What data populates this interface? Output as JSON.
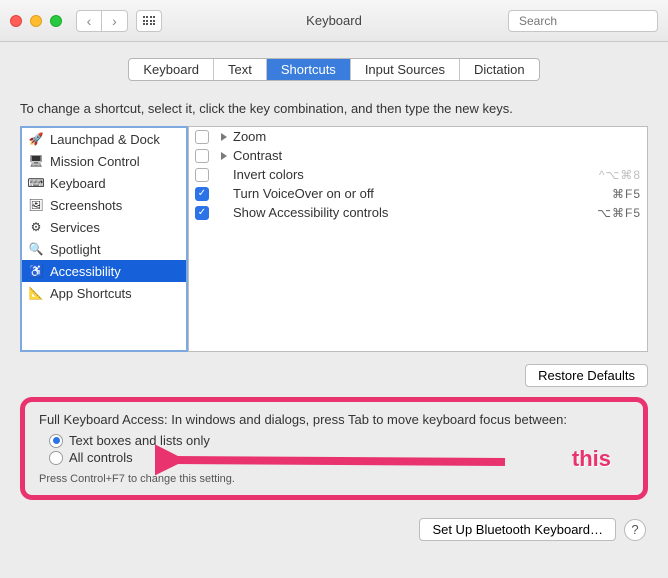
{
  "window": {
    "title": "Keyboard"
  },
  "search": {
    "placeholder": "Search"
  },
  "tabs": [
    {
      "label": "Keyboard",
      "active": false
    },
    {
      "label": "Text",
      "active": false
    },
    {
      "label": "Shortcuts",
      "active": true
    },
    {
      "label": "Input Sources",
      "active": false
    },
    {
      "label": "Dictation",
      "active": false
    }
  ],
  "instruction": "To change a shortcut, select it, click the key combination, and then type the new keys.",
  "sidebar": {
    "items": [
      {
        "label": "Launchpad & Dock",
        "icon": "launchpad-icon"
      },
      {
        "label": "Mission Control",
        "icon": "mission-control-icon"
      },
      {
        "label": "Keyboard",
        "icon": "keyboard-icon"
      },
      {
        "label": "Screenshots",
        "icon": "screenshot-icon"
      },
      {
        "label": "Services",
        "icon": "gear-icon"
      },
      {
        "label": "Spotlight",
        "icon": "search-icon"
      },
      {
        "label": "Accessibility",
        "icon": "accessibility-icon",
        "selected": true
      },
      {
        "label": "App Shortcuts",
        "icon": "apps-icon"
      }
    ]
  },
  "shortcuts": {
    "rows": [
      {
        "checked": false,
        "expandable": true,
        "label": "Zoom",
        "shortcut": ""
      },
      {
        "checked": false,
        "expandable": true,
        "label": "Contrast",
        "shortcut": ""
      },
      {
        "checked": false,
        "expandable": false,
        "label": "Invert colors",
        "shortcut": "^⌥⌘8",
        "dim": true
      },
      {
        "checked": true,
        "expandable": false,
        "label": "Turn VoiceOver on or off",
        "shortcut": "⌘F5"
      },
      {
        "checked": true,
        "expandable": false,
        "label": "Show Accessibility controls",
        "shortcut": "⌥⌘F5"
      }
    ]
  },
  "buttons": {
    "restore": "Restore Defaults",
    "bluetooth": "Set Up Bluetooth Keyboard…"
  },
  "fka": {
    "heading": "Full Keyboard Access: In windows and dialogs, press Tab to move keyboard focus between:",
    "option1": "Text boxes and lists only",
    "option2": "All controls",
    "selected": 0,
    "hint": "Press Control+F7 to change this setting."
  },
  "annotation": {
    "label": "this"
  }
}
